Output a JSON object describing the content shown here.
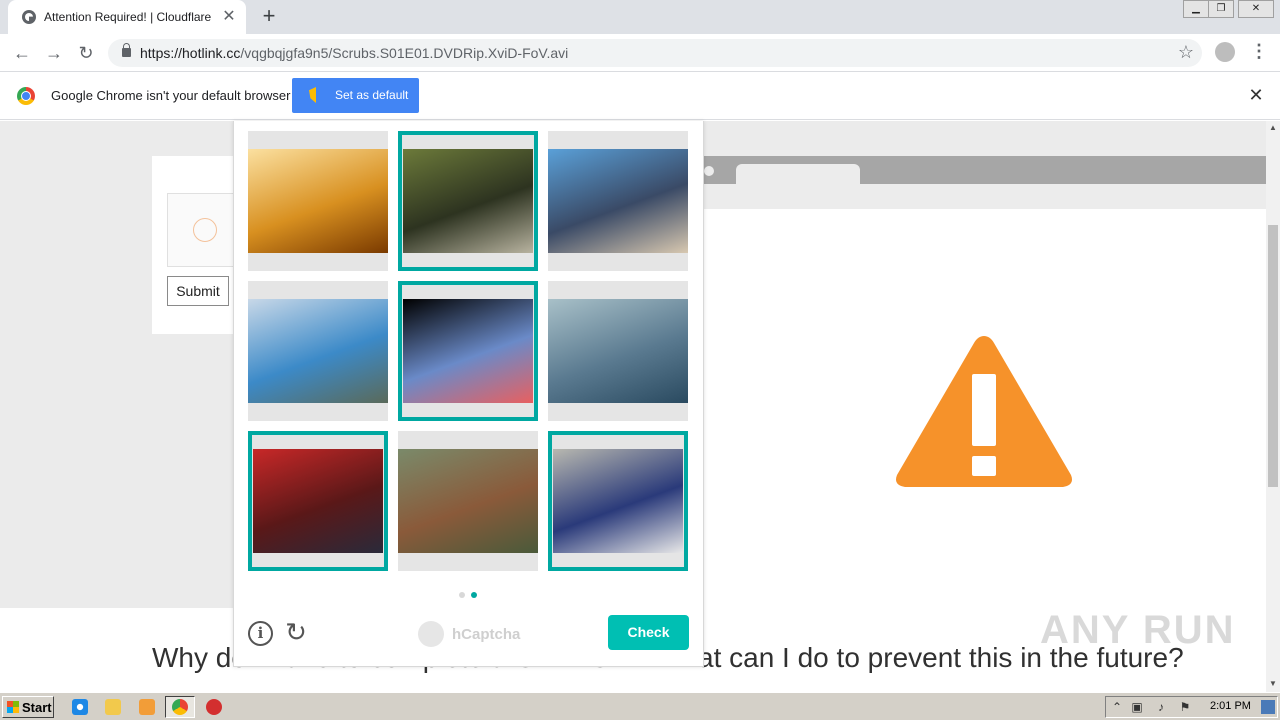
{
  "browser": {
    "tab_title": "Attention Required! | Cloudflare",
    "tab_close": "✕",
    "new_tab": "+",
    "url_host": "https://hotlink.cc",
    "url_path": "/vqgbqjgfa9n5/Scrubs.S01E01.DVDRip.XviD-FoV.avi",
    "window_controls": [
      "minimize",
      "restore",
      "close"
    ]
  },
  "infobar": {
    "message": "Google Chrome isn't your default browser",
    "button_label": "Set as default",
    "close": "✕"
  },
  "page": {
    "submit_label": "Submit",
    "heading_left": "Why do I have to complete a CAPTCHA?",
    "heading_right": "What can I do to prevent this in the future?"
  },
  "hcaptcha": {
    "tiles": [
      {
        "name": "tile-lamps",
        "selected": false,
        "colors": [
          "#fbe0a0",
          "#d89020",
          "#7a3a00"
        ]
      },
      {
        "name": "tile-umbrella-garden",
        "selected": true,
        "colors": [
          "#6c7a3a",
          "#2d3320",
          "#b8b3a0"
        ]
      },
      {
        "name": "tile-umbrella-hand",
        "selected": false,
        "colors": [
          "#5aa0d8",
          "#3a4a66",
          "#d8c8b0"
        ]
      },
      {
        "name": "tile-bus",
        "selected": false,
        "colors": [
          "#c8d8e8",
          "#3c8ac8",
          "#5a6a5a"
        ]
      },
      {
        "name": "tile-reporter-umbrella",
        "selected": true,
        "colors": [
          "#000000",
          "#6a8ac8",
          "#e86060"
        ]
      },
      {
        "name": "tile-boat",
        "selected": false,
        "colors": [
          "#a8c0c8",
          "#5a7a90",
          "#2a4a60"
        ]
      },
      {
        "name": "tile-red-umbrella",
        "selected": true,
        "colors": [
          "#c82828",
          "#5a1818",
          "#2a2a3a"
        ]
      },
      {
        "name": "tile-rowboat",
        "selected": false,
        "colors": [
          "#7a8a6a",
          "#8a5a3a",
          "#4a5a3a"
        ]
      },
      {
        "name": "tile-two-umbrellas",
        "selected": true,
        "colors": [
          "#b8b8b0",
          "#2a3a7a",
          "#e8e8e8"
        ]
      }
    ],
    "page_dots": [
      {
        "active": false
      },
      {
        "active": true
      }
    ],
    "brand": "hCaptcha",
    "check_label": "Check",
    "info_glyph": "i",
    "refresh_glyph": "↻"
  },
  "watermark": "ANY RUN",
  "taskbar": {
    "start_label": "Start",
    "clock": "2:01 PM"
  },
  "colors": {
    "accent": "#00a8a1",
    "check_button": "#00bfb3",
    "chrome_blue": "#4285f4",
    "warning": "#f6922a"
  }
}
